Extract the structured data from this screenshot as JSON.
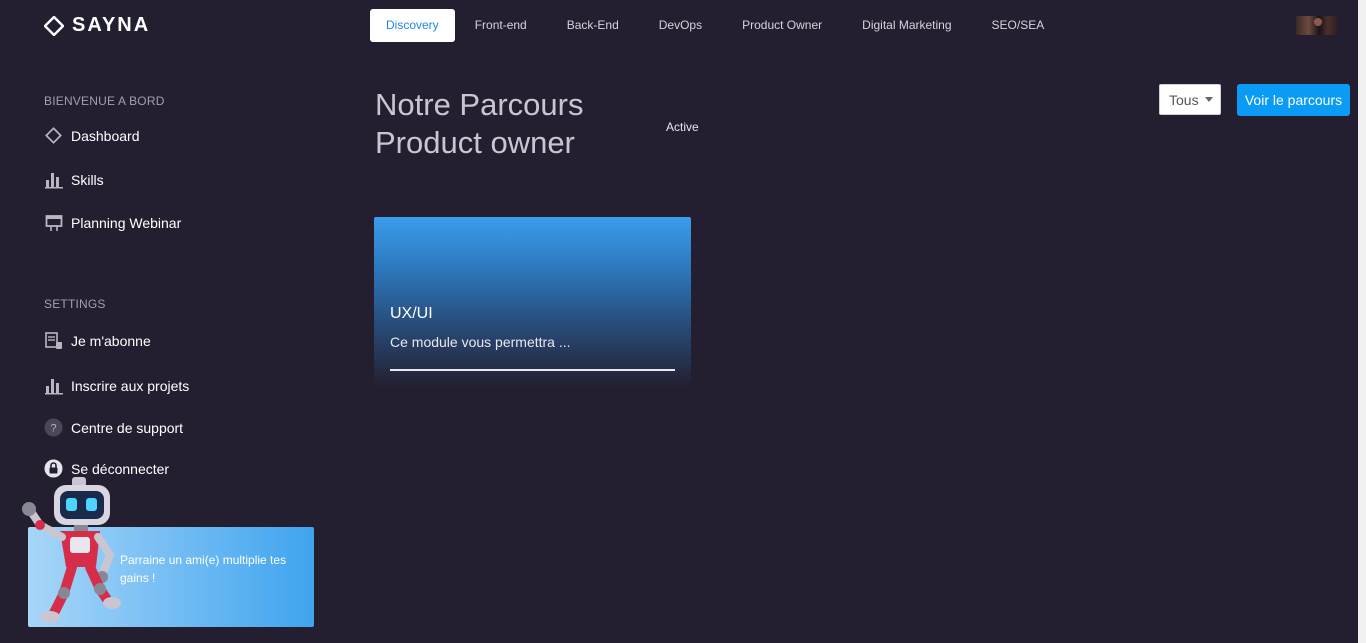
{
  "brand": {
    "name": "SAYNA"
  },
  "nav": {
    "items": [
      {
        "label": "Discovery",
        "active": true
      },
      {
        "label": "Front-end"
      },
      {
        "label": "Back-End"
      },
      {
        "label": "DevOps"
      },
      {
        "label": "Product Owner"
      },
      {
        "label": "Digital Marketing"
      },
      {
        "label": "SEO/SEA"
      }
    ]
  },
  "sidebar": {
    "section_welcome": "BIENVENUE A BORD",
    "welcome_items": [
      {
        "label": "Dashboard",
        "icon": "dashboard-icon"
      },
      {
        "label": "Skills",
        "icon": "bar-chart-icon"
      },
      {
        "label": "Planning Webinar",
        "icon": "calendar-icon"
      }
    ],
    "section_settings": "SETTINGS",
    "settings_items": [
      {
        "label": "Je m'abonne",
        "icon": "subscribe-icon"
      },
      {
        "label": "Inscrire aux projets",
        "icon": "bar-chart-icon"
      },
      {
        "label": "Centre de support",
        "icon": "help-icon"
      },
      {
        "label": "Se déconnecter",
        "icon": "lock-icon"
      }
    ]
  },
  "main": {
    "title": "Notre Parcours Product owner",
    "status": "Active",
    "filter": {
      "selected": "Tous"
    },
    "primary_button": "Voir le parcours",
    "modules": [
      {
        "title": "UX/UI",
        "description": "Ce module vous permettra ...",
        "progress": 1.0
      }
    ]
  },
  "promo": {
    "text": "Parraine un ami(e) multiplie tes gains !"
  },
  "colors": {
    "background": "#231f30",
    "accent": "#0a9cf5",
    "active_nav_text": "#1e88e5"
  }
}
